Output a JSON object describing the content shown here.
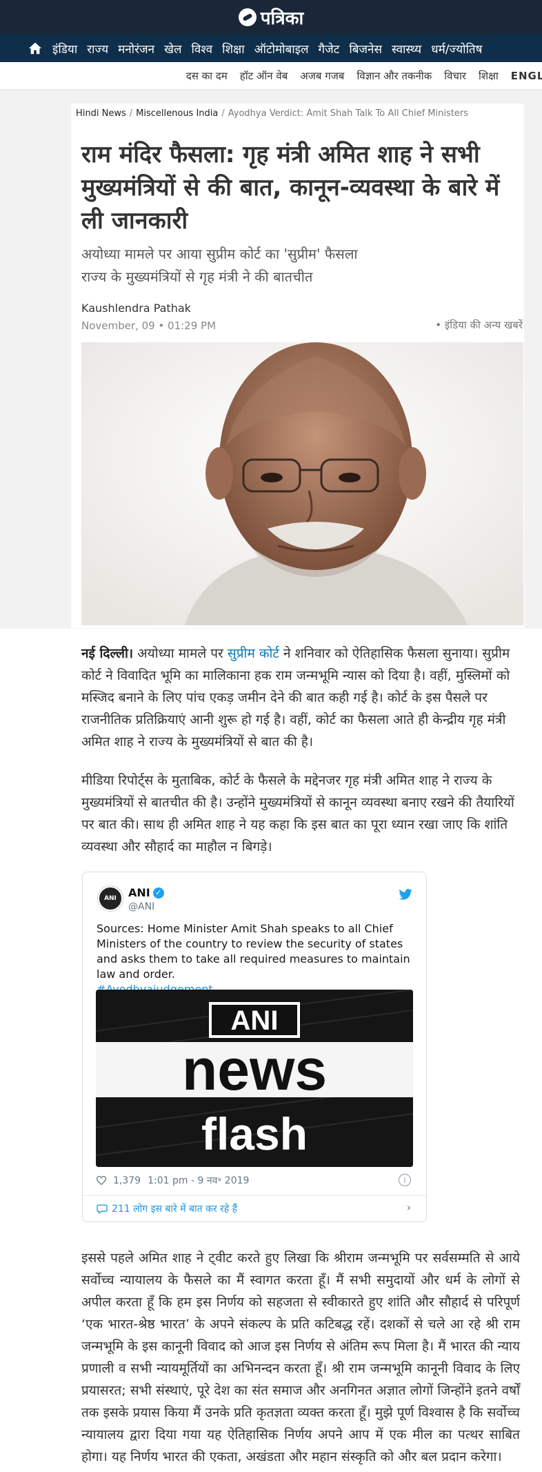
{
  "site": {
    "name": "पत्रिका"
  },
  "nav": {
    "items": [
      "इंडिया",
      "राज्य",
      "मनोरंजन",
      "खेल",
      "विश्व",
      "शिक्षा",
      "ऑटोमोबाइल",
      "गैजेट",
      "बिजनेस",
      "स्वास्थ्य",
      "धर्म/ज्योतिष"
    ]
  },
  "subnav": {
    "items": [
      "दस का दम",
      "हॉट ऑन वेब",
      "अजब गजब",
      "विज्ञान और तकनीक",
      "विचार",
      "शिक्षा",
      "ENGLI"
    ]
  },
  "breadcrumb": {
    "items": [
      "Hindi News",
      "Miscellenous India",
      "Ayodhya Verdict: Amit Shah Talk To All Chief Ministers"
    ]
  },
  "article": {
    "headline": "राम मंदिर फैसला: गृह मंत्री अमित शाह ने सभी मुख्यमंत्रियों से की बात, कानून-व्यवस्था के बारे में ली जानकारी",
    "subhead_1": "अयोध्या मामले पर आया सुप्रीम कोर्ट का 'सुप्रीम' फैसला",
    "subhead_2": "राज्य के मुख्यमंत्रियों से गृह मंत्री ने की बातचीत",
    "author": "Kaushlendra Pathak",
    "date": "November, 09 • 01:29 PM",
    "more_news": "• इंडिया की अन्य खबरें",
    "p1_dateline": "नई दिल्ली।",
    "p1_a": " अयोध्या मामले पर ",
    "p1_link": "सुप्रीम कोर्ट",
    "p1_b": " ने शनिवार को ऐतिहासिक फैसला सुनाया। सुप्रीम कोर्ट ने विवादित भूमि का मालिकाना हक राम जन्मभूमि न्यास को दिया है। वहीं, मुस्लिमों को मस्जिद बनाने के लिए पांच एकड़ जमीन देने की बात कही गई है। कोर्ट के इस पैसले पर राजनीतिक प्रतिक्रियाएं आनी शुरू हो गई है। वहीं, कोर्ट का फैसला आते ही केन्द्रीय गृह मंत्री अमित शाह ने राज्य के मुख्यमंत्रियों से बात की है।",
    "p2": "मीडिया रिपोर्ट्स के मुताबिक, कोर्ट के फैसले के मद्देनजर गृह मंत्री अमित शाह ने राज्य के मुख्यमंत्रियों से बातचीत की है। उन्होंने मुख्यमंत्रियों से कानून व्यवस्था बनाए रखने की तैयारियों पर बात की। साथ ही अमित शाह ने यह कहा कि इस बात का पूरा ध्यान रखा जाए कि शांति व्यवस्था और सौहार्द का माहौल न बिगड़े।",
    "p3": "इससे पहले अमित शाह ने ट्वीट करते हुए लिखा कि श्रीराम जन्मभूमि पर सर्वसम्मति से आये सर्वोच्च न्यायालय के फैसले का मैं स्वागत करता हूँ। मैं सभी समुदायों और धर्म के लोगों से अपील करता हूँ कि हम इस निर्णय को सहजता से स्वीकारते हुए शांति और सौहार्द से परिपूर्ण ‘एक भारत-श्रेष्ठ भारत’ के अपने संकल्प के प्रति कटिबद्ध रहें। दशकों से चले आ रहे श्री राम जन्मभूमि के इस कानूनी विवाद को आज इस निर्णय से अंतिम रूप मिला है। मैं भारत की न्याय प्रणाली व सभी न्यायमूर्तियों का अभिनन्दन करता हूँ। श्री राम जन्मभूमि कानूनी विवाद के लिए प्रयासरत; सभी संस्थाएं, पूरे देश का संत समाज और अनगिनत अज्ञात लोगों जिन्होंने इतने वर्षों तक इसके प्रयास किया मैं उनके प्रति कृतज्ञता व्यक्त करता हूँ। मुझे पूर्ण विश्वास है कि सर्वोच्च न्यायालय द्वारा दिया गया यह ऐतिहासिक निर्णय अपने आप में एक मील का पत्थर साबित होगा। यह निर्णय भारत की एकता, अखंडता और महान संस्कृति को और बल प्रदान करेगा।"
  },
  "tweet": {
    "avatar_text": "ANI",
    "name": "ANI",
    "handle": "@ANI",
    "text": "Sources: Home Minister Amit Shah speaks to all Chief Ministers of the country to review the security of states and asks them to take all required measures to maintain law and order.",
    "hashtag": "#Ayodhyajudgement",
    "media_line1": "ANI",
    "media_line2": "news",
    "media_line3": "flash",
    "likes": "1,379",
    "time": "1:01 pm - 9 नव॰ 2019",
    "conversation": "211 लोग इस बारे में बात कर रहे हैं",
    "colors": {
      "link": "#1b95e0",
      "verified": "#1da1f2"
    }
  },
  "icons": [
    "home-icon",
    "verified-icon",
    "twitter-bird-icon",
    "heart-icon",
    "info-icon",
    "comment-icon",
    "chevron-right-icon"
  ]
}
